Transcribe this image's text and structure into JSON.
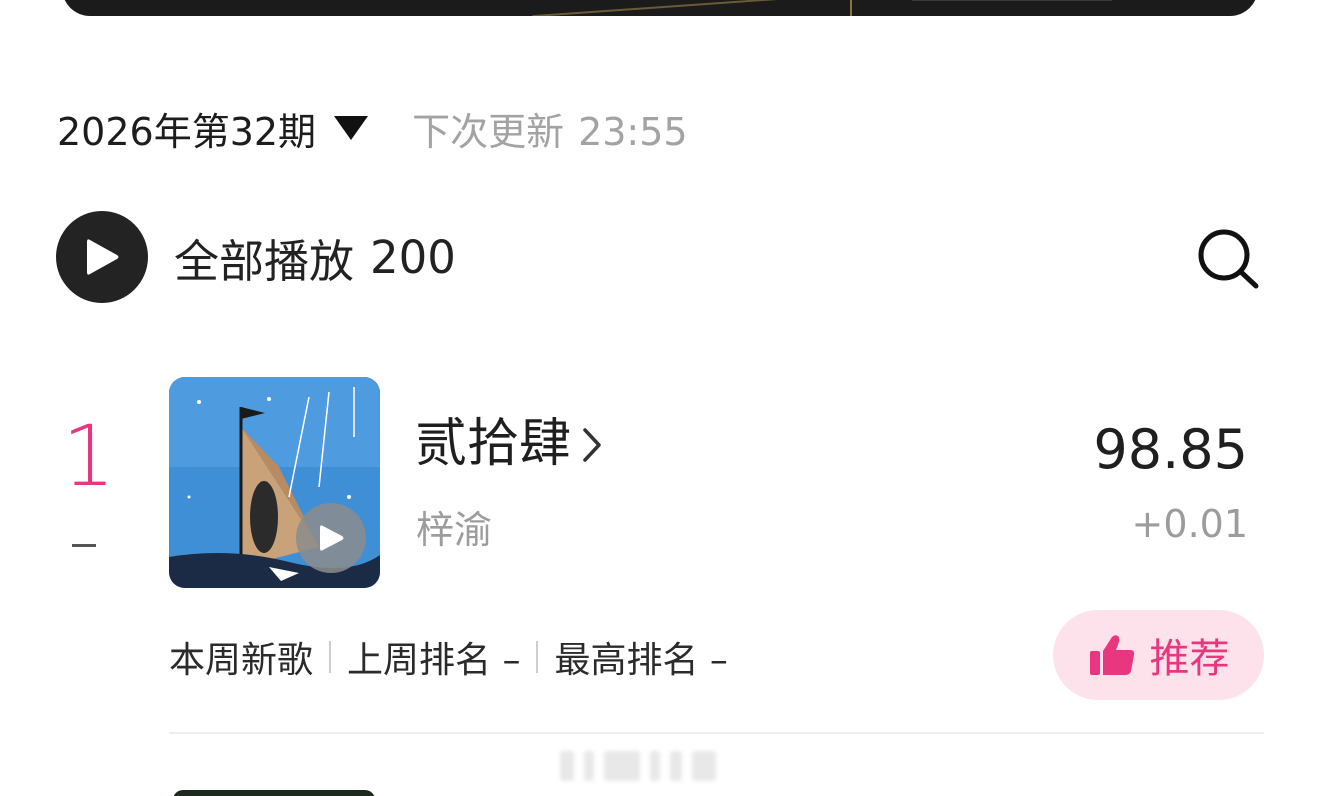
{
  "issue": {
    "label": "2026年第32期",
    "next_update_label": "下次更新",
    "next_update_time": "23:55"
  },
  "playall": {
    "label": "全部播放",
    "count": "200"
  },
  "icons": {
    "play": "play-icon",
    "search": "search-icon",
    "dropdown": "caret-down-icon",
    "chevron": "chevron-right-icon",
    "thumb": "thumbs-up-icon"
  },
  "colors": {
    "accent": "#e8377f",
    "recommend_bg": "#fde2ec",
    "cover_bg": "#3f8fd6"
  },
  "items": [
    {
      "rank": "1",
      "rank_change": "–",
      "title": "贰拾肆",
      "artist": "梓渝",
      "score": "98.85",
      "score_delta": "+0.01",
      "tags": {
        "new_song": "本周新歌",
        "last_week": "上周排名 –",
        "peak": "最高排名 –"
      },
      "recommend_label": "推荐"
    }
  ]
}
